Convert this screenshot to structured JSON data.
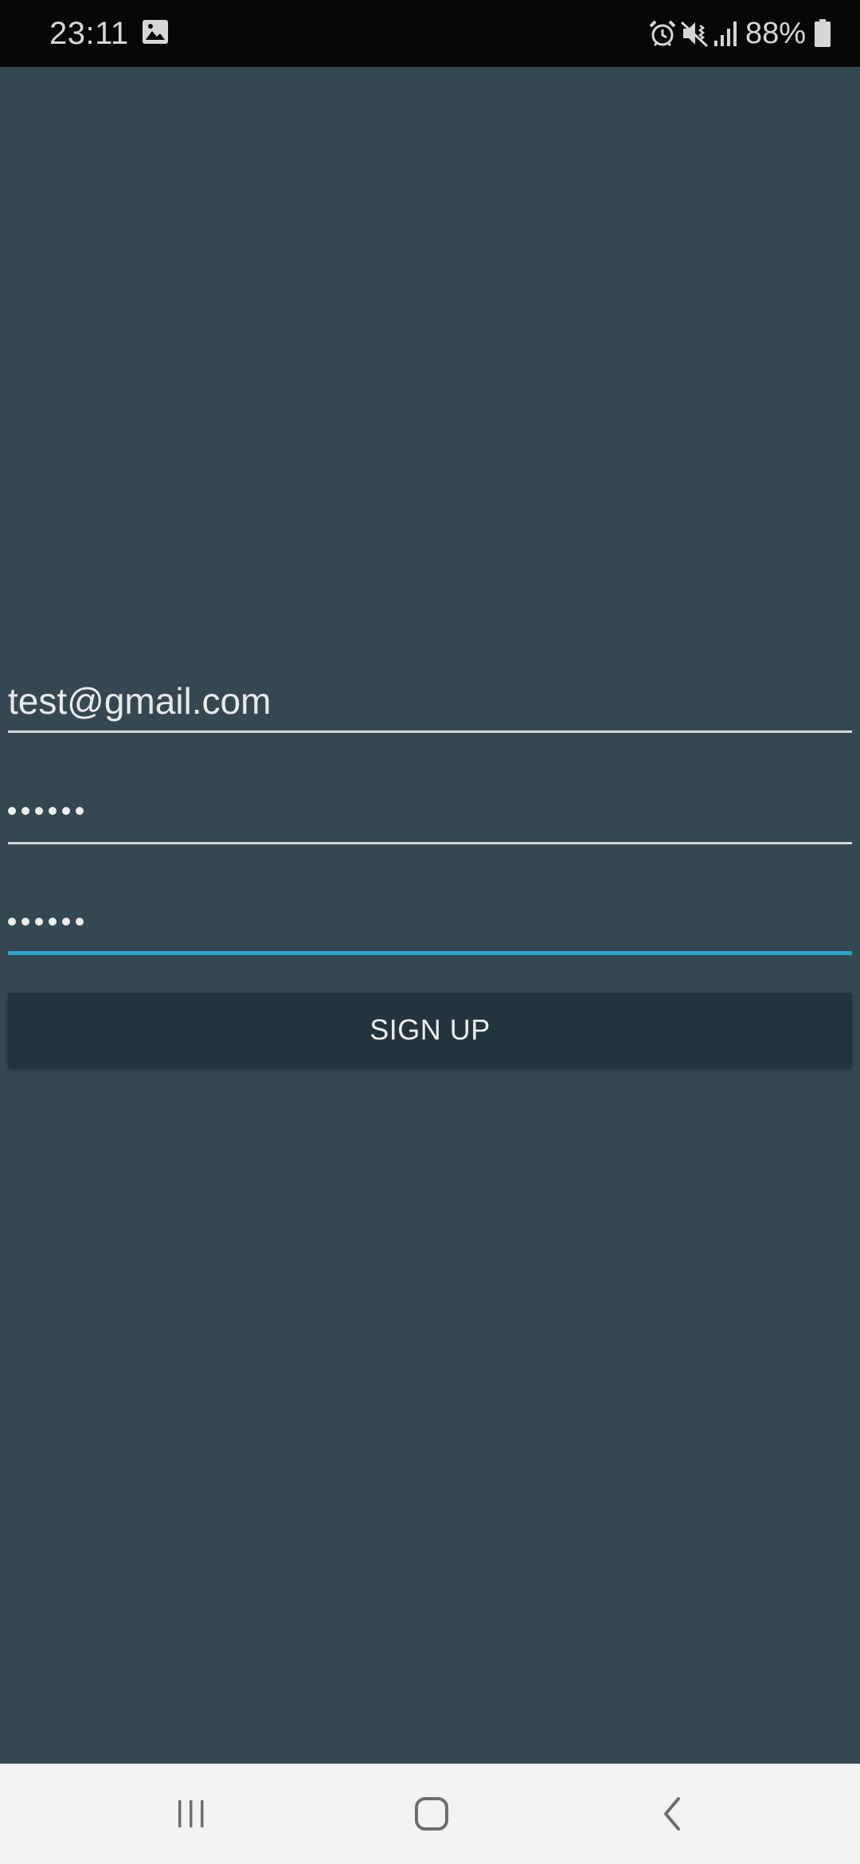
{
  "status_bar": {
    "time": "23:11",
    "battery_percent": "88%",
    "icons": [
      "gallery-icon",
      "alarm-icon",
      "vibrate-mute-icon",
      "signal-icon",
      "battery-icon"
    ],
    "battery_level": 0.88
  },
  "form": {
    "email": {
      "value": "test@gmail.com"
    },
    "password": {
      "value": "......",
      "masked_length": 6
    },
    "confirm_password": {
      "value": "......",
      "masked_length": 6,
      "focused": true
    },
    "signup_label": "SIGN UP"
  },
  "colors": {
    "background": "#354852",
    "button": "#24343e",
    "accent": "#2aa6c9",
    "status_bar": "#070707",
    "nav_bar": "#f2f2f2"
  },
  "nav_bar": {
    "buttons": [
      "recent-apps-icon",
      "home-icon",
      "back-icon"
    ]
  }
}
